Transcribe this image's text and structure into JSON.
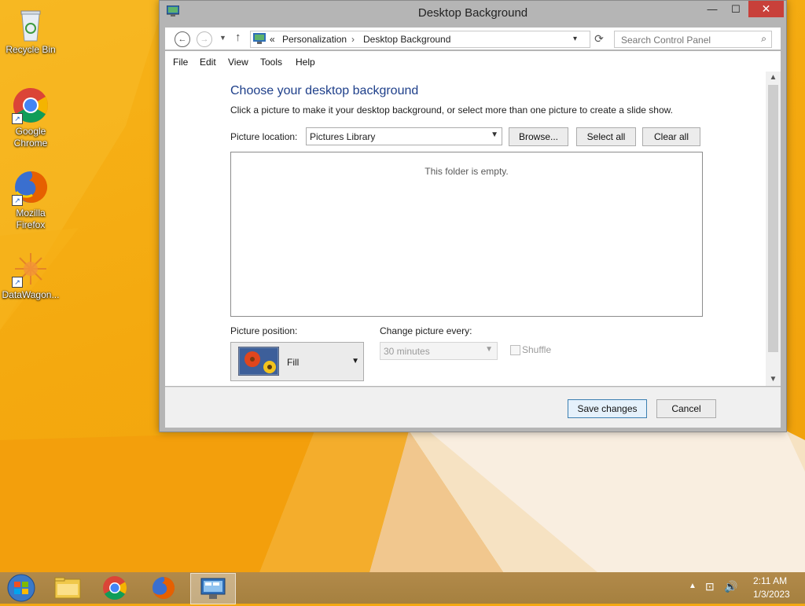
{
  "desktop": {
    "icons": [
      {
        "label": "Recycle Bin"
      },
      {
        "label": "Google\nChrome"
      },
      {
        "label": "Mozilla\nFirefox"
      },
      {
        "label": "DataWagon..."
      }
    ]
  },
  "window": {
    "title": "Desktop Background",
    "controls": {
      "minimize": "—",
      "maximize": "☐",
      "close": "✕"
    },
    "address": {
      "overflow": "«",
      "crumbs": [
        "Personalization",
        "Desktop Background"
      ],
      "separator": "›"
    },
    "search": {
      "placeholder": "Search Control Panel"
    },
    "menu": [
      "File",
      "Edit",
      "View",
      "Tools",
      "Help"
    ],
    "content": {
      "heading": "Choose your desktop background",
      "subtext": "Click a picture to make it your desktop background, or select more than one picture to create a slide show.",
      "picture_location_label": "Picture location:",
      "picture_location_value": "Pictures Library",
      "browse_label": "Browse...",
      "select_all_label": "Select all",
      "clear_all_label": "Clear all",
      "empty_message": "This folder is empty.",
      "picture_position_label": "Picture position:",
      "picture_position_value": "Fill",
      "change_every_label": "Change picture every:",
      "change_every_value": "30 minutes",
      "shuffle_label": "Shuffle"
    },
    "footer": {
      "save_label": "Save changes",
      "cancel_label": "Cancel"
    }
  },
  "taskbar": {
    "time": "2:11 AM",
    "date": "1/3/2023"
  },
  "colors": {
    "heading": "#1e3f8a",
    "close_button": "#c8403a",
    "taskbar": "#a5803f"
  }
}
